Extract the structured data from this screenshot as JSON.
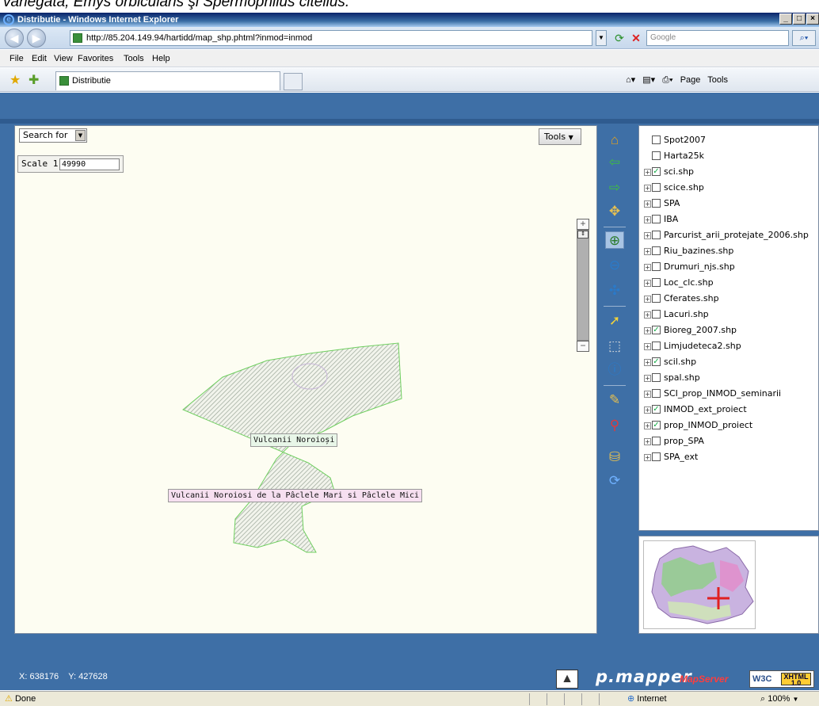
{
  "caption": "variegata, Emys orbicularis şi Spermophilus citellus.",
  "browser": {
    "title": "Distributie - Windows Internet Explorer",
    "url": "http://85.204.149.94/hartidd/map_shp.phtml?inmod=inmod",
    "search_placeholder": "Google",
    "menu": [
      "File",
      "Edit",
      "View",
      "Favorites",
      "Tools",
      "Help"
    ],
    "tab_title": "Distributie",
    "command_bar": [
      "Page",
      "Tools"
    ],
    "status_text": "Done",
    "zone": "Internet",
    "zoom": "100%"
  },
  "map": {
    "search_label": "Search for",
    "tools_label": "Tools",
    "scale_label": "Scale 1:",
    "scale_value": "49990",
    "labels": [
      "Vulcanii Noroioși",
      "Vulcanii Noroiosi de la Pâclele Mari si Pâclele Mici"
    ]
  },
  "toolbar": {
    "tools": [
      "home-icon",
      "back-arrow-icon",
      "forward-arrow-icon",
      "zoom-extent-icon",
      "zoom-in-icon",
      "zoom-out-icon",
      "pan-icon",
      "identify-pointer-icon",
      "select-icon",
      "info-icon",
      "measure-icon",
      "point-pin-icon",
      "paint-bucket-icon",
      "refresh-icon"
    ],
    "selected_tool": "zoom-in-icon"
  },
  "layers": [
    {
      "name": "Spot2007",
      "checked": false,
      "expandable": false
    },
    {
      "name": "Harta25k",
      "checked": false,
      "expandable": false
    },
    {
      "name": "sci.shp",
      "checked": true,
      "expandable": true
    },
    {
      "name": "scice.shp",
      "checked": false,
      "expandable": true
    },
    {
      "name": "SPA",
      "checked": false,
      "expandable": true
    },
    {
      "name": "IBA",
      "checked": false,
      "expandable": true
    },
    {
      "name": "Parcurist_arii_protejate_2006.shp",
      "checked": false,
      "expandable": true
    },
    {
      "name": "Riu_bazines.shp",
      "checked": false,
      "expandable": true
    },
    {
      "name": "Drumuri_njs.shp",
      "checked": false,
      "expandable": true
    },
    {
      "name": "Loc_clc.shp",
      "checked": false,
      "expandable": true
    },
    {
      "name": "Cferates.shp",
      "checked": false,
      "expandable": true
    },
    {
      "name": "Lacuri.shp",
      "checked": false,
      "expandable": true
    },
    {
      "name": "Bioreg_2007.shp",
      "checked": true,
      "expandable": true
    },
    {
      "name": "Limjudeteca2.shp",
      "checked": false,
      "expandable": true
    },
    {
      "name": "scil.shp",
      "checked": true,
      "expandable": true
    },
    {
      "name": "spal.shp",
      "checked": false,
      "expandable": true
    },
    {
      "name": "SCI_prop_INMOD_seminarii",
      "checked": false,
      "expandable": true
    },
    {
      "name": "INMOD_ext_proiect",
      "checked": true,
      "expandable": true
    },
    {
      "name": "prop_INMOD_proiect",
      "checked": true,
      "expandable": true
    },
    {
      "name": "prop_SPA",
      "checked": false,
      "expandable": true
    },
    {
      "name": "SPA_ext",
      "checked": false,
      "expandable": true
    }
  ],
  "footer": {
    "x_label": "X:",
    "x_value": "638176",
    "y_label": "Y:",
    "y_value": "427628",
    "logo": "p.mapper",
    "mapserver_badge": "MapServer",
    "w3c_badge": "W3C",
    "xhtml_badge": "XHTML 1.0"
  }
}
